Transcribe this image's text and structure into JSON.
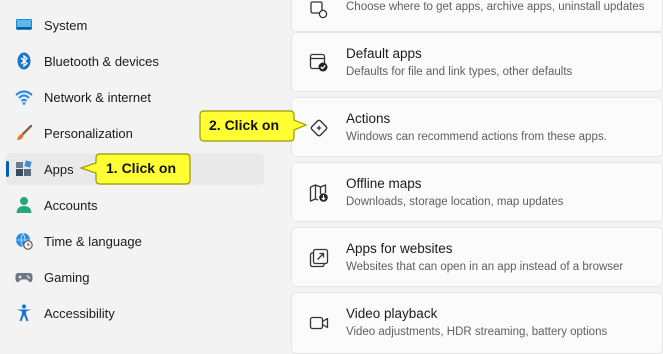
{
  "sidebar": {
    "items": [
      {
        "label": "System",
        "icon": "system-icon"
      },
      {
        "label": "Bluetooth & devices",
        "icon": "bluetooth-icon"
      },
      {
        "label": "Network & internet",
        "icon": "wifi-icon"
      },
      {
        "label": "Personalization",
        "icon": "brush-icon"
      },
      {
        "label": "Apps",
        "icon": "apps-icon",
        "selected": true
      },
      {
        "label": "Accounts",
        "icon": "account-icon"
      },
      {
        "label": "Time & language",
        "icon": "globe-clock-icon"
      },
      {
        "label": "Gaming",
        "icon": "gamepad-icon"
      },
      {
        "label": "Accessibility",
        "icon": "accessibility-icon"
      }
    ]
  },
  "cards": [
    {
      "title": "",
      "desc": "Choose where to get apps, archive apps, uninstall updates",
      "icon": "advanced-settings-icon"
    },
    {
      "title": "Default apps",
      "desc": "Defaults for file and link types, other defaults",
      "icon": "default-apps-icon"
    },
    {
      "title": "Actions",
      "desc": "Windows can recommend actions from these apps.",
      "icon": "actions-icon"
    },
    {
      "title": "Offline maps",
      "desc": "Downloads, storage location, map updates",
      "icon": "offline-maps-icon"
    },
    {
      "title": "Apps for websites",
      "desc": "Websites that can open in an app instead of a browser",
      "icon": "open-in-app-icon"
    },
    {
      "title": "Video playback",
      "desc": "Video adjustments, HDR streaming, battery options",
      "icon": "video-icon"
    }
  ],
  "callouts": {
    "step1": "1. Click on",
    "step2": "2. Click on"
  },
  "colors": {
    "accent": "#005fb8",
    "callout_fill": "#ffff33",
    "callout_border": "#999900"
  }
}
